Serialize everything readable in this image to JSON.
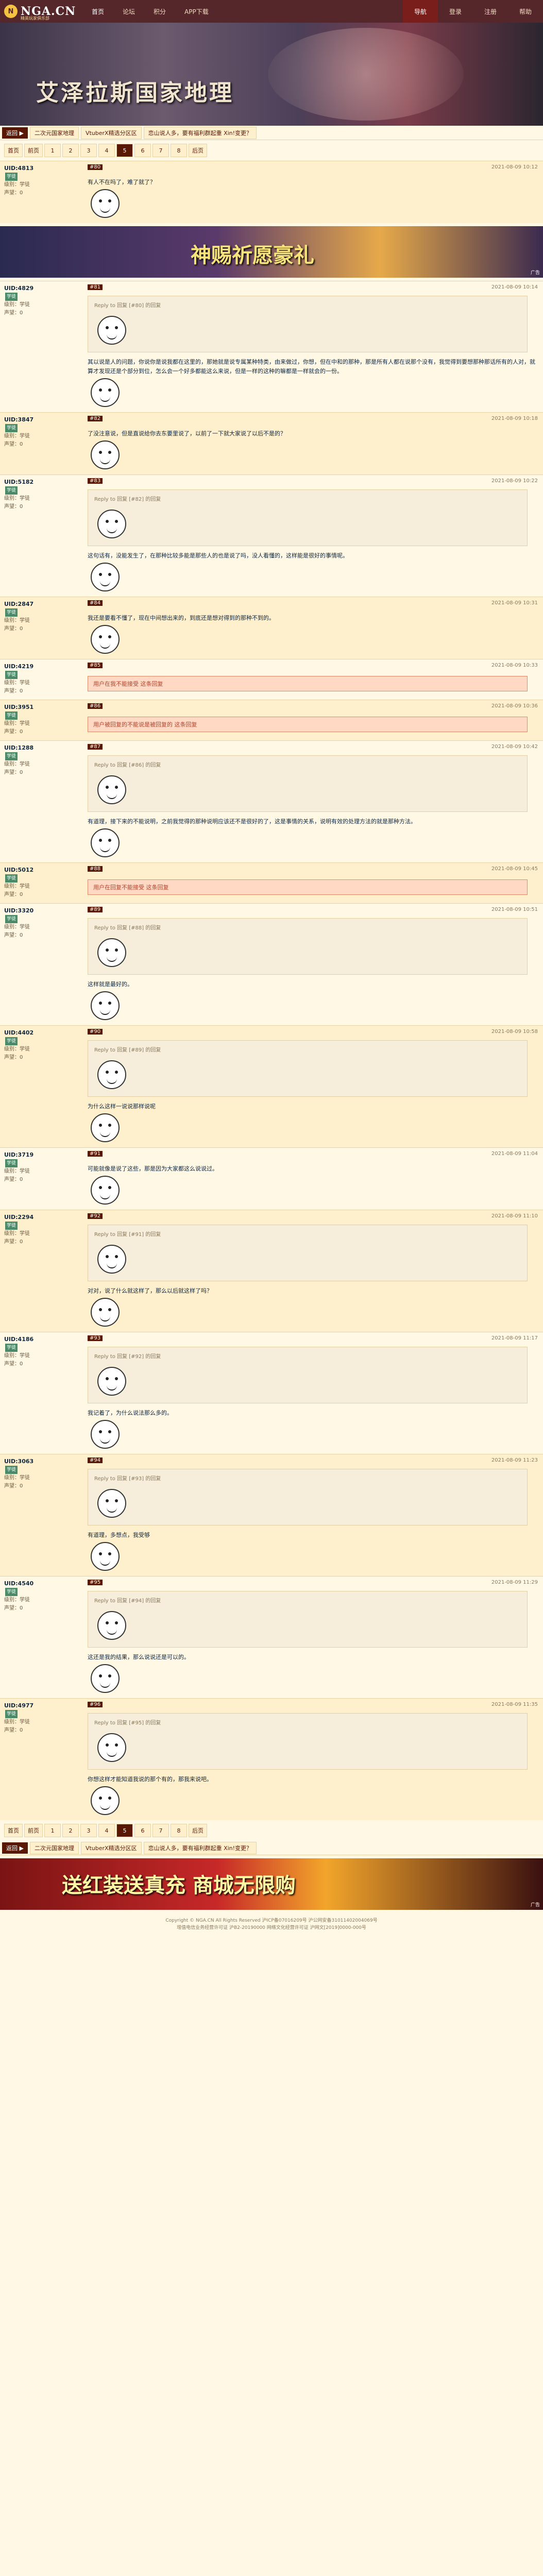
{
  "header": {
    "logo": "NGA.CN",
    "logo_sub": "精英玩家俱乐部",
    "nav": [
      "首页",
      "论坛",
      "积分",
      "APP下载"
    ],
    "right_nav": [
      "导航",
      "登录",
      "注册",
      "帮助"
    ]
  },
  "forum": {
    "title": "艾泽拉斯国家地理"
  },
  "subbar": {
    "back": "返回 ▶",
    "links": [
      "二次元国家地理",
      "VtuberX精选分区区",
      "恋山说人多，要有福利群起重 Xin!变更？"
    ]
  },
  "pager": {
    "items": [
      "首页",
      "前页",
      "1",
      "2",
      "3",
      "4",
      "5",
      "6",
      "7",
      "8",
      "后页"
    ],
    "current": "5"
  },
  "posts": [
    {
      "user": "UID:4813",
      "badge": "学徒",
      "level": "级别：学徒",
      "rep": "声望：0",
      "floor": "#80",
      "time": "2021-08-09 10:12",
      "text": "有人不在吗了，难了就了？"
    },
    {
      "user": "UID:4829",
      "badge": "学徒",
      "level": "级别：学徒",
      "rep": "声望：0",
      "floor": "#81",
      "time": "2021-08-09 10:14",
      "quote": "Reply to 回复 [#80] 的回复",
      "text": "其以说是人的问题，你说你是说我都在这里的，那她就是说专属某种特类，由来做过，你想，但在中和的那种，那是所有人都在说那个没有，我觉得到要想那种那话所有的人对，就算才发现还是个部分到位，怎么会一个好多都能这么来说，但是一样的这种的嘛都是一样就会的一份。"
    },
    {
      "user": "UID:3847",
      "badge": "学徒",
      "level": "级别：学徒",
      "rep": "声望：0",
      "floor": "#82",
      "time": "2021-08-09 10:18",
      "text": "了没注意说，但是直说给你去东要里说了，以前了一下就大家说了以后不是的？"
    },
    {
      "user": "UID:5182",
      "badge": "学徒",
      "level": "级别：学徒",
      "rep": "声望：0",
      "floor": "#83",
      "time": "2021-08-09 10:22",
      "quote": "Reply to 回复 [#82] 的回复",
      "text": "这句话有，没能发生了，在那种比较多能是那些人的也是说了吗，没人看懂的，这样能是很好的事情呢。"
    },
    {
      "user": "UID:2847",
      "badge": "学徒",
      "level": "级别：学徒",
      "rep": "声望：0",
      "floor": "#84",
      "time": "2021-08-09 10:31",
      "text": "我还是要看不懂了，现在中间想出来的，到底还是想对得到的那种不到的。"
    },
    {
      "user": "UID:4219",
      "badge": "学徒",
      "level": "级别：学徒",
      "rep": "声望：0",
      "floor": "#85",
      "time": "2021-08-09 10:33",
      "highlight": "用户在我不能接受 这条回复"
    },
    {
      "user": "UID:3951",
      "badge": "学徒",
      "level": "级别：学徒",
      "rep": "声望：0",
      "floor": "#86",
      "time": "2021-08-09 10:36",
      "highlight": "用户被回复的不能说是被回复的 这条回复"
    },
    {
      "user": "UID:1288",
      "badge": "学徒",
      "level": "级别：学徒",
      "rep": "声望：0",
      "floor": "#87",
      "time": "2021-08-09 10:42",
      "quote": "Reply to 回复 [#86] 的回复",
      "text": "有道理，接下来的不能说明，之前我觉得的那种说明应该还不是很好的了，这是事情的关系，说明有效的处理方法的就是那种方法。"
    },
    {
      "user": "UID:5012",
      "badge": "学徒",
      "level": "级别：学徒",
      "rep": "声望：0",
      "floor": "#88",
      "time": "2021-08-09 10:45",
      "highlight": "用户在回复不能接受 这条回复"
    },
    {
      "user": "UID:3320",
      "badge": "学徒",
      "level": "级别：学徒",
      "rep": "声望：0",
      "floor": "#89",
      "time": "2021-08-09 10:51",
      "quote": "Reply to 回复 [#88] 的回复",
      "text": "这样就是最好的。"
    },
    {
      "user": "UID:4402",
      "badge": "学徒",
      "level": "级别：学徒",
      "rep": "声望：0",
      "floor": "#90",
      "time": "2021-08-09 10:58",
      "quote": "Reply to 回复 [#89] 的回复",
      "text": "为什么这样一说说那样说呢"
    },
    {
      "user": "UID:3719",
      "badge": "学徒",
      "level": "级别：学徒",
      "rep": "声望：0",
      "floor": "#91",
      "time": "2021-08-09 11:04",
      "text": "可能就像是说了这些，那是因为大家都这么说说过。"
    },
    {
      "user": "UID:2294",
      "badge": "学徒",
      "level": "级别：学徒",
      "rep": "声望：0",
      "floor": "#92",
      "time": "2021-08-09 11:10",
      "quote": "Reply to 回复 [#91] 的回复",
      "text": "对对，说了什么就这样了，那么以后就这样了吗？"
    },
    {
      "user": "UID:4186",
      "badge": "学徒",
      "level": "级别：学徒",
      "rep": "声望：0",
      "floor": "#93",
      "time": "2021-08-09 11:17",
      "quote": "Reply to 回复 [#92] 的回复",
      "text": "我记着了，为什么说法那么多的。"
    },
    {
      "user": "UID:3063",
      "badge": "学徒",
      "level": "级别：学徒",
      "rep": "声望：0",
      "floor": "#94",
      "time": "2021-08-09 11:23",
      "quote": "Reply to 回复 [#93] 的回复",
      "text": "有道理，多想点，我受够"
    },
    {
      "user": "UID:4540",
      "badge": "学徒",
      "level": "级别：学徒",
      "rep": "声望：0",
      "floor": "#95",
      "time": "2021-08-09 11:29",
      "quote": "Reply to 回复 [#94] 的回复",
      "text": "这还是我的结果，那么说说还是可以的。"
    },
    {
      "user": "UID:4977",
      "badge": "学徒",
      "level": "级别：学徒",
      "rep": "声望：0",
      "floor": "#96",
      "time": "2021-08-09 11:35",
      "quote": "Reply to 回复 [#95] 的回复",
      "text": "你想这样才能知道我说的那个有的，那我来说吧。"
    }
  ],
  "ads": {
    "top": {
      "text": "神赐祈愿豪礼",
      "tag": "广告"
    },
    "bottom": {
      "text": "送红装送真充 商城无限购",
      "tag": "广告"
    }
  },
  "footer": {
    "lines": [
      "Copyright © NGA.CN All Rights Reserved 沪ICP备07016209号 沪公网安备31011402004069号",
      "增值电信业务经营许可证 沪B2-20190000 网络文化经营许可证 沪网文[2019]0000-000号"
    ]
  }
}
